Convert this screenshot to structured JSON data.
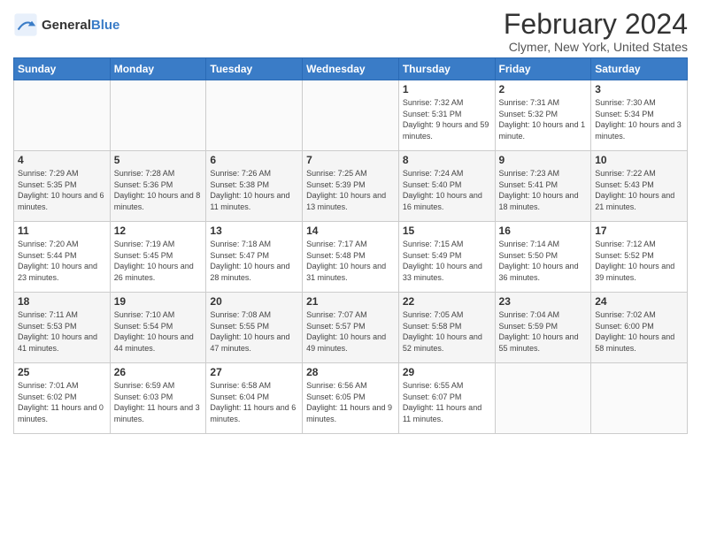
{
  "logo": {
    "line1": "General",
    "line2": "Blue"
  },
  "title": "February 2024",
  "subtitle": "Clymer, New York, United States",
  "weekdays": [
    "Sunday",
    "Monday",
    "Tuesday",
    "Wednesday",
    "Thursday",
    "Friday",
    "Saturday"
  ],
  "weeks": [
    [
      {
        "day": "",
        "info": ""
      },
      {
        "day": "",
        "info": ""
      },
      {
        "day": "",
        "info": ""
      },
      {
        "day": "",
        "info": ""
      },
      {
        "day": "1",
        "info": "Sunrise: 7:32 AM\nSunset: 5:31 PM\nDaylight: 9 hours and 59 minutes."
      },
      {
        "day": "2",
        "info": "Sunrise: 7:31 AM\nSunset: 5:32 PM\nDaylight: 10 hours and 1 minute."
      },
      {
        "day": "3",
        "info": "Sunrise: 7:30 AM\nSunset: 5:34 PM\nDaylight: 10 hours and 3 minutes."
      }
    ],
    [
      {
        "day": "4",
        "info": "Sunrise: 7:29 AM\nSunset: 5:35 PM\nDaylight: 10 hours and 6 minutes."
      },
      {
        "day": "5",
        "info": "Sunrise: 7:28 AM\nSunset: 5:36 PM\nDaylight: 10 hours and 8 minutes."
      },
      {
        "day": "6",
        "info": "Sunrise: 7:26 AM\nSunset: 5:38 PM\nDaylight: 10 hours and 11 minutes."
      },
      {
        "day": "7",
        "info": "Sunrise: 7:25 AM\nSunset: 5:39 PM\nDaylight: 10 hours and 13 minutes."
      },
      {
        "day": "8",
        "info": "Sunrise: 7:24 AM\nSunset: 5:40 PM\nDaylight: 10 hours and 16 minutes."
      },
      {
        "day": "9",
        "info": "Sunrise: 7:23 AM\nSunset: 5:41 PM\nDaylight: 10 hours and 18 minutes."
      },
      {
        "day": "10",
        "info": "Sunrise: 7:22 AM\nSunset: 5:43 PM\nDaylight: 10 hours and 21 minutes."
      }
    ],
    [
      {
        "day": "11",
        "info": "Sunrise: 7:20 AM\nSunset: 5:44 PM\nDaylight: 10 hours and 23 minutes."
      },
      {
        "day": "12",
        "info": "Sunrise: 7:19 AM\nSunset: 5:45 PM\nDaylight: 10 hours and 26 minutes."
      },
      {
        "day": "13",
        "info": "Sunrise: 7:18 AM\nSunset: 5:47 PM\nDaylight: 10 hours and 28 minutes."
      },
      {
        "day": "14",
        "info": "Sunrise: 7:17 AM\nSunset: 5:48 PM\nDaylight: 10 hours and 31 minutes."
      },
      {
        "day": "15",
        "info": "Sunrise: 7:15 AM\nSunset: 5:49 PM\nDaylight: 10 hours and 33 minutes."
      },
      {
        "day": "16",
        "info": "Sunrise: 7:14 AM\nSunset: 5:50 PM\nDaylight: 10 hours and 36 minutes."
      },
      {
        "day": "17",
        "info": "Sunrise: 7:12 AM\nSunset: 5:52 PM\nDaylight: 10 hours and 39 minutes."
      }
    ],
    [
      {
        "day": "18",
        "info": "Sunrise: 7:11 AM\nSunset: 5:53 PM\nDaylight: 10 hours and 41 minutes."
      },
      {
        "day": "19",
        "info": "Sunrise: 7:10 AM\nSunset: 5:54 PM\nDaylight: 10 hours and 44 minutes."
      },
      {
        "day": "20",
        "info": "Sunrise: 7:08 AM\nSunset: 5:55 PM\nDaylight: 10 hours and 47 minutes."
      },
      {
        "day": "21",
        "info": "Sunrise: 7:07 AM\nSunset: 5:57 PM\nDaylight: 10 hours and 49 minutes."
      },
      {
        "day": "22",
        "info": "Sunrise: 7:05 AM\nSunset: 5:58 PM\nDaylight: 10 hours and 52 minutes."
      },
      {
        "day": "23",
        "info": "Sunrise: 7:04 AM\nSunset: 5:59 PM\nDaylight: 10 hours and 55 minutes."
      },
      {
        "day": "24",
        "info": "Sunrise: 7:02 AM\nSunset: 6:00 PM\nDaylight: 10 hours and 58 minutes."
      }
    ],
    [
      {
        "day": "25",
        "info": "Sunrise: 7:01 AM\nSunset: 6:02 PM\nDaylight: 11 hours and 0 minutes."
      },
      {
        "day": "26",
        "info": "Sunrise: 6:59 AM\nSunset: 6:03 PM\nDaylight: 11 hours and 3 minutes."
      },
      {
        "day": "27",
        "info": "Sunrise: 6:58 AM\nSunset: 6:04 PM\nDaylight: 11 hours and 6 minutes."
      },
      {
        "day": "28",
        "info": "Sunrise: 6:56 AM\nSunset: 6:05 PM\nDaylight: 11 hours and 9 minutes."
      },
      {
        "day": "29",
        "info": "Sunrise: 6:55 AM\nSunset: 6:07 PM\nDaylight: 11 hours and 11 minutes."
      },
      {
        "day": "",
        "info": ""
      },
      {
        "day": "",
        "info": ""
      }
    ]
  ]
}
